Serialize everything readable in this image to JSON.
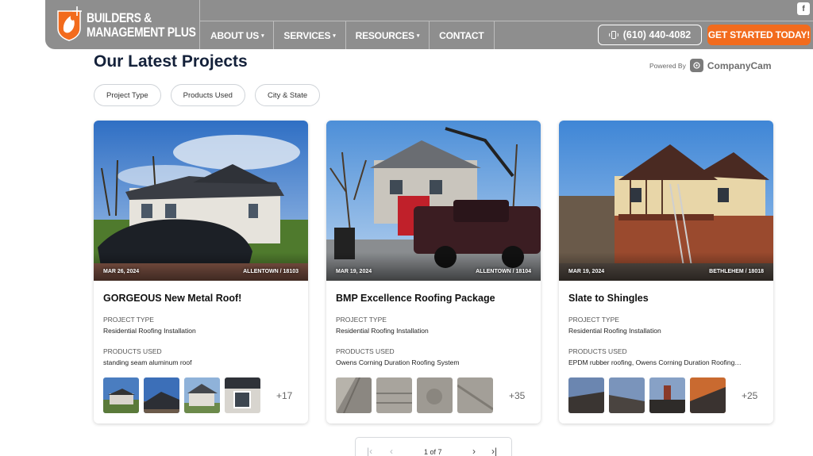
{
  "header": {
    "logo_line1": "BUILDERS &",
    "logo_line2": "MANAGEMENT PLUS",
    "nav": [
      {
        "label": "ABOUT US",
        "caret": "▾"
      },
      {
        "label": "SERVICES",
        "caret": "▾"
      },
      {
        "label": "RESOURCES",
        "caret": "▾"
      },
      {
        "label": "CONTACT",
        "caret": ""
      }
    ],
    "phone": "(610) 440-4082",
    "cta": "GET STARTED TODAY!",
    "social_icon": "f",
    "brand_color": "#f26b1d",
    "bar_color": "#8e8e8e"
  },
  "section": {
    "title": "Our Latest Projects",
    "powered_by": "Powered By",
    "powered_name": "CompanyCam"
  },
  "filters": [
    "Project Type",
    "Products Used",
    "City & State"
  ],
  "cards": [
    {
      "date": "MAR 26, 2024",
      "location": "ALLENTOWN / 18103",
      "title": "GORGEOUS New Metal Roof!",
      "type_label": "PROJECT TYPE",
      "type": "Residential Roofing Installation",
      "products_label": "PRODUCTS USED",
      "products": "standing seam aluminum roof",
      "more": "+17"
    },
    {
      "date": "MAR 19, 2024",
      "location": "ALLENTOWN / 18104",
      "title": "BMP Excellence Roofing Package",
      "type_label": "PROJECT TYPE",
      "type": "Residential Roofing Installation",
      "products_label": "PRODUCTS USED",
      "products": "Owens Corning Duration Roofing System",
      "more": "+35"
    },
    {
      "date": "MAR 19, 2024",
      "location": "BETHLEHEM / 18018",
      "title": "Slate to Shingles",
      "type_label": "PROJECT TYPE",
      "type": "Residential Roofing Installation",
      "products_label": "PRODUCTS USED",
      "products": "EPDM rubber roofing, Owens Corning Duration Roofing…",
      "more": "+25"
    }
  ],
  "pagination": {
    "first": "|‹",
    "prev": "‹",
    "text": "1 of 7",
    "next": "›",
    "last": "›|"
  }
}
